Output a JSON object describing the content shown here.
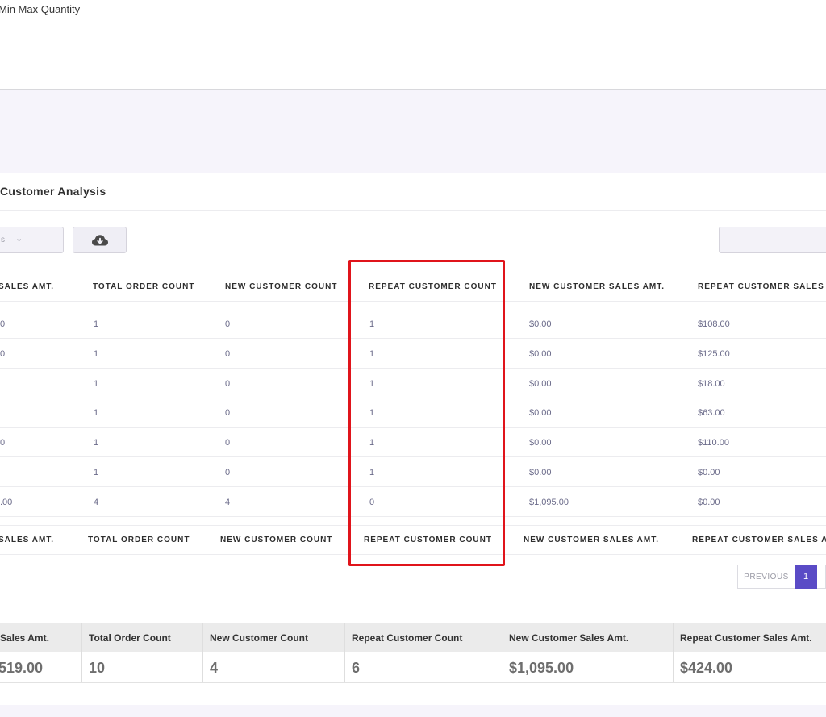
{
  "top": {
    "title": "Min Max Quantity"
  },
  "section": {
    "title": "Customer Analysis"
  },
  "toolbar": {
    "select_value": "s",
    "download_icon": "cloud-download-icon",
    "search_placeholder": ""
  },
  "table": {
    "headers": [
      "SALES AMT.",
      "TOTAL ORDER COUNT",
      "NEW CUSTOMER COUNT",
      "REPEAT CUSTOMER COUNT",
      "NEW CUSTOMER SALES AMT.",
      "REPEAT CUSTOMER SALES A"
    ],
    "rows": [
      [
        "0",
        "1",
        "0",
        "1",
        "$0.00",
        "$108.00"
      ],
      [
        "0",
        "1",
        "0",
        "1",
        "$0.00",
        "$125.00"
      ],
      [
        "",
        "1",
        "0",
        "1",
        "$0.00",
        "$18.00"
      ],
      [
        "",
        "1",
        "0",
        "1",
        "$0.00",
        "$63.00"
      ],
      [
        "0",
        "1",
        "0",
        "1",
        "$0.00",
        "$110.00"
      ],
      [
        "",
        "1",
        "0",
        "1",
        "$0.00",
        "$0.00"
      ],
      [
        ".00",
        "4",
        "4",
        "0",
        "$1,095.00",
        "$0.00"
      ]
    ],
    "footers": [
      "SALES AMT.",
      "TOTAL ORDER COUNT",
      "NEW CUSTOMER COUNT",
      "REPEAT CUSTOMER COUNT",
      "NEW CUSTOMER SALES AMT.",
      "REPEAT CUSTOMER SALES AM"
    ]
  },
  "highlight": {
    "color": "#e0141b",
    "column": "REPEAT CUSTOMER COUNT"
  },
  "pagination": {
    "previous": "PREVIOUS",
    "current_page": "1",
    "accent": "#5a4bc6"
  },
  "summary": {
    "headers": [
      "Sales Amt.",
      "Total Order Count",
      "New Customer Count",
      "Repeat Customer Count",
      "New Customer Sales Amt.",
      "Repeat Customer Sales Amt."
    ],
    "values": [
      "519.00",
      "10",
      "4",
      "6",
      "$1,095.00",
      "$424.00"
    ]
  }
}
